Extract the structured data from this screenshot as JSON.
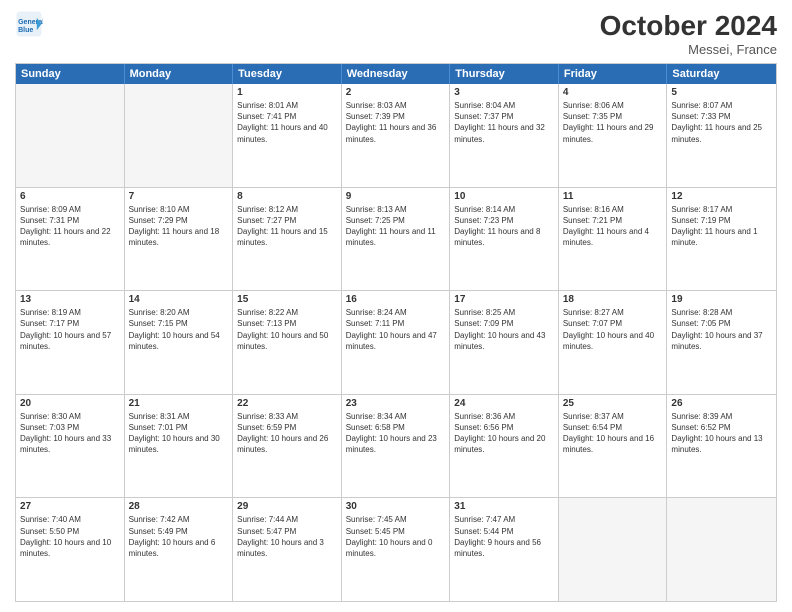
{
  "logo": {
    "line1": "General",
    "line2": "Blue",
    "icon": "▶"
  },
  "title": "October 2024",
  "location": "Messei, France",
  "weekdays": [
    "Sunday",
    "Monday",
    "Tuesday",
    "Wednesday",
    "Thursday",
    "Friday",
    "Saturday"
  ],
  "rows": [
    [
      {
        "day": "",
        "info": "",
        "empty": true
      },
      {
        "day": "",
        "info": "",
        "empty": true
      },
      {
        "day": "1",
        "info": "Sunrise: 8:01 AM\nSunset: 7:41 PM\nDaylight: 11 hours and 40 minutes."
      },
      {
        "day": "2",
        "info": "Sunrise: 8:03 AM\nSunset: 7:39 PM\nDaylight: 11 hours and 36 minutes."
      },
      {
        "day": "3",
        "info": "Sunrise: 8:04 AM\nSunset: 7:37 PM\nDaylight: 11 hours and 32 minutes."
      },
      {
        "day": "4",
        "info": "Sunrise: 8:06 AM\nSunset: 7:35 PM\nDaylight: 11 hours and 29 minutes."
      },
      {
        "day": "5",
        "info": "Sunrise: 8:07 AM\nSunset: 7:33 PM\nDaylight: 11 hours and 25 minutes."
      }
    ],
    [
      {
        "day": "6",
        "info": "Sunrise: 8:09 AM\nSunset: 7:31 PM\nDaylight: 11 hours and 22 minutes."
      },
      {
        "day": "7",
        "info": "Sunrise: 8:10 AM\nSunset: 7:29 PM\nDaylight: 11 hours and 18 minutes."
      },
      {
        "day": "8",
        "info": "Sunrise: 8:12 AM\nSunset: 7:27 PM\nDaylight: 11 hours and 15 minutes."
      },
      {
        "day": "9",
        "info": "Sunrise: 8:13 AM\nSunset: 7:25 PM\nDaylight: 11 hours and 11 minutes."
      },
      {
        "day": "10",
        "info": "Sunrise: 8:14 AM\nSunset: 7:23 PM\nDaylight: 11 hours and 8 minutes."
      },
      {
        "day": "11",
        "info": "Sunrise: 8:16 AM\nSunset: 7:21 PM\nDaylight: 11 hours and 4 minutes."
      },
      {
        "day": "12",
        "info": "Sunrise: 8:17 AM\nSunset: 7:19 PM\nDaylight: 11 hours and 1 minute."
      }
    ],
    [
      {
        "day": "13",
        "info": "Sunrise: 8:19 AM\nSunset: 7:17 PM\nDaylight: 10 hours and 57 minutes."
      },
      {
        "day": "14",
        "info": "Sunrise: 8:20 AM\nSunset: 7:15 PM\nDaylight: 10 hours and 54 minutes."
      },
      {
        "day": "15",
        "info": "Sunrise: 8:22 AM\nSunset: 7:13 PM\nDaylight: 10 hours and 50 minutes."
      },
      {
        "day": "16",
        "info": "Sunrise: 8:24 AM\nSunset: 7:11 PM\nDaylight: 10 hours and 47 minutes."
      },
      {
        "day": "17",
        "info": "Sunrise: 8:25 AM\nSunset: 7:09 PM\nDaylight: 10 hours and 43 minutes."
      },
      {
        "day": "18",
        "info": "Sunrise: 8:27 AM\nSunset: 7:07 PM\nDaylight: 10 hours and 40 minutes."
      },
      {
        "day": "19",
        "info": "Sunrise: 8:28 AM\nSunset: 7:05 PM\nDaylight: 10 hours and 37 minutes."
      }
    ],
    [
      {
        "day": "20",
        "info": "Sunrise: 8:30 AM\nSunset: 7:03 PM\nDaylight: 10 hours and 33 minutes."
      },
      {
        "day": "21",
        "info": "Sunrise: 8:31 AM\nSunset: 7:01 PM\nDaylight: 10 hours and 30 minutes."
      },
      {
        "day": "22",
        "info": "Sunrise: 8:33 AM\nSunset: 6:59 PM\nDaylight: 10 hours and 26 minutes."
      },
      {
        "day": "23",
        "info": "Sunrise: 8:34 AM\nSunset: 6:58 PM\nDaylight: 10 hours and 23 minutes."
      },
      {
        "day": "24",
        "info": "Sunrise: 8:36 AM\nSunset: 6:56 PM\nDaylight: 10 hours and 20 minutes."
      },
      {
        "day": "25",
        "info": "Sunrise: 8:37 AM\nSunset: 6:54 PM\nDaylight: 10 hours and 16 minutes."
      },
      {
        "day": "26",
        "info": "Sunrise: 8:39 AM\nSunset: 6:52 PM\nDaylight: 10 hours and 13 minutes."
      }
    ],
    [
      {
        "day": "27",
        "info": "Sunrise: 7:40 AM\nSunset: 5:50 PM\nDaylight: 10 hours and 10 minutes."
      },
      {
        "day": "28",
        "info": "Sunrise: 7:42 AM\nSunset: 5:49 PM\nDaylight: 10 hours and 6 minutes."
      },
      {
        "day": "29",
        "info": "Sunrise: 7:44 AM\nSunset: 5:47 PM\nDaylight: 10 hours and 3 minutes."
      },
      {
        "day": "30",
        "info": "Sunrise: 7:45 AM\nSunset: 5:45 PM\nDaylight: 10 hours and 0 minutes."
      },
      {
        "day": "31",
        "info": "Sunrise: 7:47 AM\nSunset: 5:44 PM\nDaylight: 9 hours and 56 minutes."
      },
      {
        "day": "",
        "info": "",
        "empty": true
      },
      {
        "day": "",
        "info": "",
        "empty": true
      }
    ]
  ]
}
